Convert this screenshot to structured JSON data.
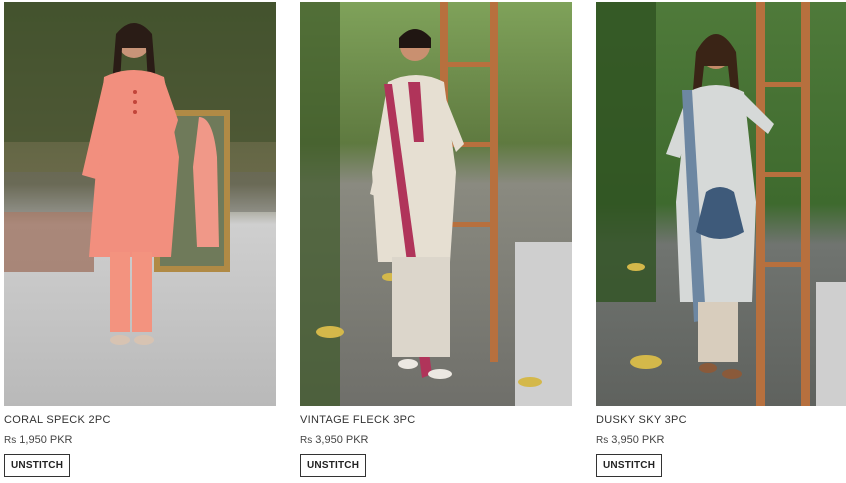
{
  "products": [
    {
      "name": "CORAL SPECK 2PC",
      "currency": "Rs",
      "price": "1,950 PKR",
      "button": "UNSTITCH",
      "image": "woman-in-coral-suit-photo",
      "accent": "#ef8a78"
    },
    {
      "name": "VINTAGE FLECK 3PC",
      "currency": "Rs",
      "price": "3,950 PKR",
      "button": "UNSTITCH",
      "image": "woman-in-beige-maroon-suit-photo",
      "accent": "#b23b5c"
    },
    {
      "name": "DUSKY SKY 3PC",
      "currency": "Rs",
      "price": "3,950 PKR",
      "button": "UNSTITCH",
      "image": "woman-in-blue-printed-suit-photo",
      "accent": "#5f7893"
    }
  ]
}
